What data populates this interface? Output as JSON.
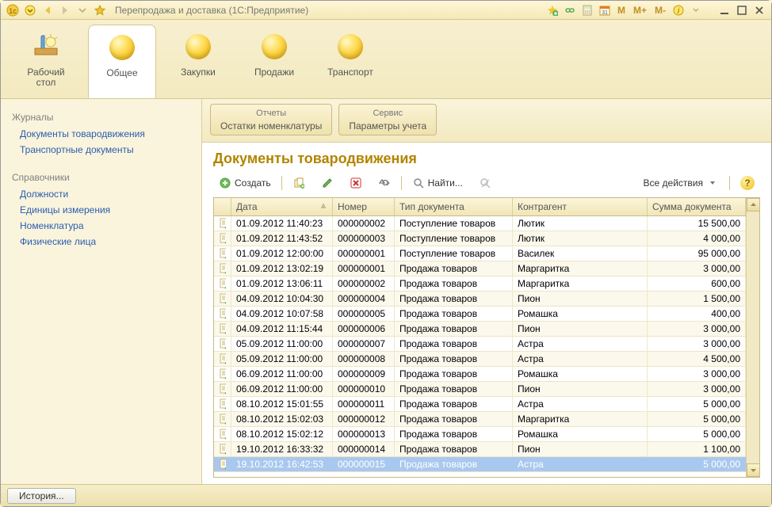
{
  "titlebar": {
    "app_title": "Перепродажа и доставка  (1С:Предприятие)",
    "mem_buttons": [
      "M",
      "M+",
      "M-"
    ]
  },
  "maintabs": [
    {
      "label": "Рабочий\nстол",
      "icon": "desk"
    },
    {
      "label": "Общее",
      "icon": "ball",
      "active": true
    },
    {
      "label": "Закупки",
      "icon": "ball"
    },
    {
      "label": "Продажи",
      "icon": "ball"
    },
    {
      "label": "Транспорт",
      "icon": "ball"
    }
  ],
  "sidebar": {
    "groups": [
      {
        "title": "Журналы",
        "links": [
          "Документы товародвижения",
          "Транспортные документы"
        ]
      },
      {
        "title": "Справочники",
        "links": [
          "Должности",
          "Единицы измерения",
          "Номенклатура",
          "Физические лица"
        ]
      }
    ]
  },
  "submenus": {
    "reports": {
      "top": "Отчеты",
      "bottom": "Остатки номенклатуры"
    },
    "service": {
      "top": "Сервис",
      "bottom": "Параметры учета"
    }
  },
  "page": {
    "title": "Документы товародвижения",
    "toolbar": {
      "create": "Создать",
      "find": "Найти...",
      "all_actions": "Все действия"
    },
    "columns": {
      "date": "Дата",
      "number": "Номер",
      "type": "Тип документа",
      "counterparty": "Контрагент",
      "sum": "Сумма документа"
    },
    "rows": [
      {
        "date": "01.09.2012 11:40:23",
        "num": "000000002",
        "type": "Поступление товаров",
        "ctr": "Лютик",
        "sum": "15 500,00"
      },
      {
        "date": "01.09.2012 11:43:52",
        "num": "000000003",
        "type": "Поступление товаров",
        "ctr": "Лютик",
        "sum": "4 000,00"
      },
      {
        "date": "01.09.2012 12:00:00",
        "num": "000000001",
        "type": "Поступление товаров",
        "ctr": "Василек",
        "sum": "95 000,00"
      },
      {
        "date": "01.09.2012 13:02:19",
        "num": "000000001",
        "type": "Продажа товаров",
        "ctr": "Маргаритка",
        "sum": "3 000,00"
      },
      {
        "date": "01.09.2012 13:06:11",
        "num": "000000002",
        "type": "Продажа товаров",
        "ctr": "Маргаритка",
        "sum": "600,00"
      },
      {
        "date": "04.09.2012 10:04:30",
        "num": "000000004",
        "type": "Продажа товаров",
        "ctr": "Пион",
        "sum": "1 500,00"
      },
      {
        "date": "04.09.2012 10:07:58",
        "num": "000000005",
        "type": "Продажа товаров",
        "ctr": "Ромашка",
        "sum": "400,00"
      },
      {
        "date": "04.09.2012 11:15:44",
        "num": "000000006",
        "type": "Продажа товаров",
        "ctr": "Пион",
        "sum": "3 000,00"
      },
      {
        "date": "05.09.2012 11:00:00",
        "num": "000000007",
        "type": "Продажа товаров",
        "ctr": "Астра",
        "sum": "3 000,00"
      },
      {
        "date": "05.09.2012 11:00:00",
        "num": "000000008",
        "type": "Продажа товаров",
        "ctr": "Астра",
        "sum": "4 500,00"
      },
      {
        "date": "06.09.2012 11:00:00",
        "num": "000000009",
        "type": "Продажа товаров",
        "ctr": "Ромашка",
        "sum": "3 000,00"
      },
      {
        "date": "06.09.2012 11:00:00",
        "num": "000000010",
        "type": "Продажа товаров",
        "ctr": "Пион",
        "sum": "3 000,00"
      },
      {
        "date": "08.10.2012 15:01:55",
        "num": "000000011",
        "type": "Продажа товаров",
        "ctr": "Астра",
        "sum": "5 000,00"
      },
      {
        "date": "08.10.2012 15:02:03",
        "num": "000000012",
        "type": "Продажа товаров",
        "ctr": "Маргаритка",
        "sum": "5 000,00"
      },
      {
        "date": "08.10.2012 15:02:12",
        "num": "000000013",
        "type": "Продажа товаров",
        "ctr": "Ромашка",
        "sum": "5 000,00"
      },
      {
        "date": "19.10.2012 16:33:32",
        "num": "000000014",
        "type": "Продажа товаров",
        "ctr": "Пион",
        "sum": "1 100,00"
      },
      {
        "date": "19.10.2012 16:42:53",
        "num": "000000015",
        "type": "Продажа товаров",
        "ctr": "Астра",
        "sum": "5 000,00",
        "selected": true
      }
    ]
  },
  "footer": {
    "history": "История..."
  }
}
